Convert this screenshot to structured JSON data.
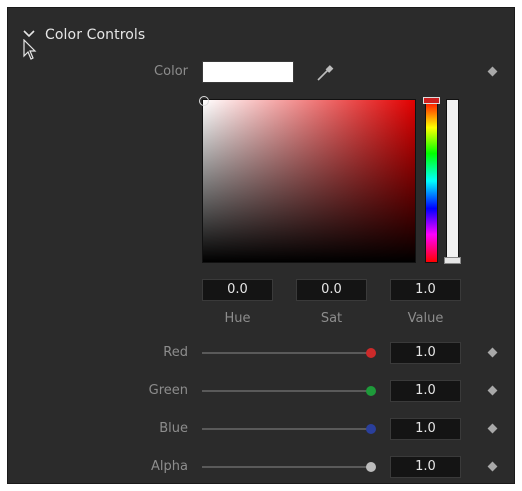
{
  "section": {
    "title": "Color Controls"
  },
  "color": {
    "label": "Color",
    "swatch": "#ffffff"
  },
  "hsv": {
    "hue": {
      "label": "Hue",
      "value": "0.0"
    },
    "sat": {
      "label": "Sat",
      "value": "0.0"
    },
    "value": {
      "label": "Value",
      "value": "1.0"
    }
  },
  "channels": {
    "red": {
      "label": "Red",
      "value": "1.0",
      "color": "#cc2a2a"
    },
    "green": {
      "label": "Green",
      "value": "1.0",
      "color": "#1e9a3a"
    },
    "blue": {
      "label": "Blue",
      "value": "1.0",
      "color": "#2a3f9c"
    },
    "alpha": {
      "label": "Alpha",
      "value": "1.0",
      "color": "#bcbcbc"
    }
  },
  "icons": {
    "collapse": "chevron-down-icon",
    "pointer": "mouse-pointer-icon",
    "eyedropper": "eyedropper-icon",
    "keyframe": "keyframe-diamond-icon"
  }
}
